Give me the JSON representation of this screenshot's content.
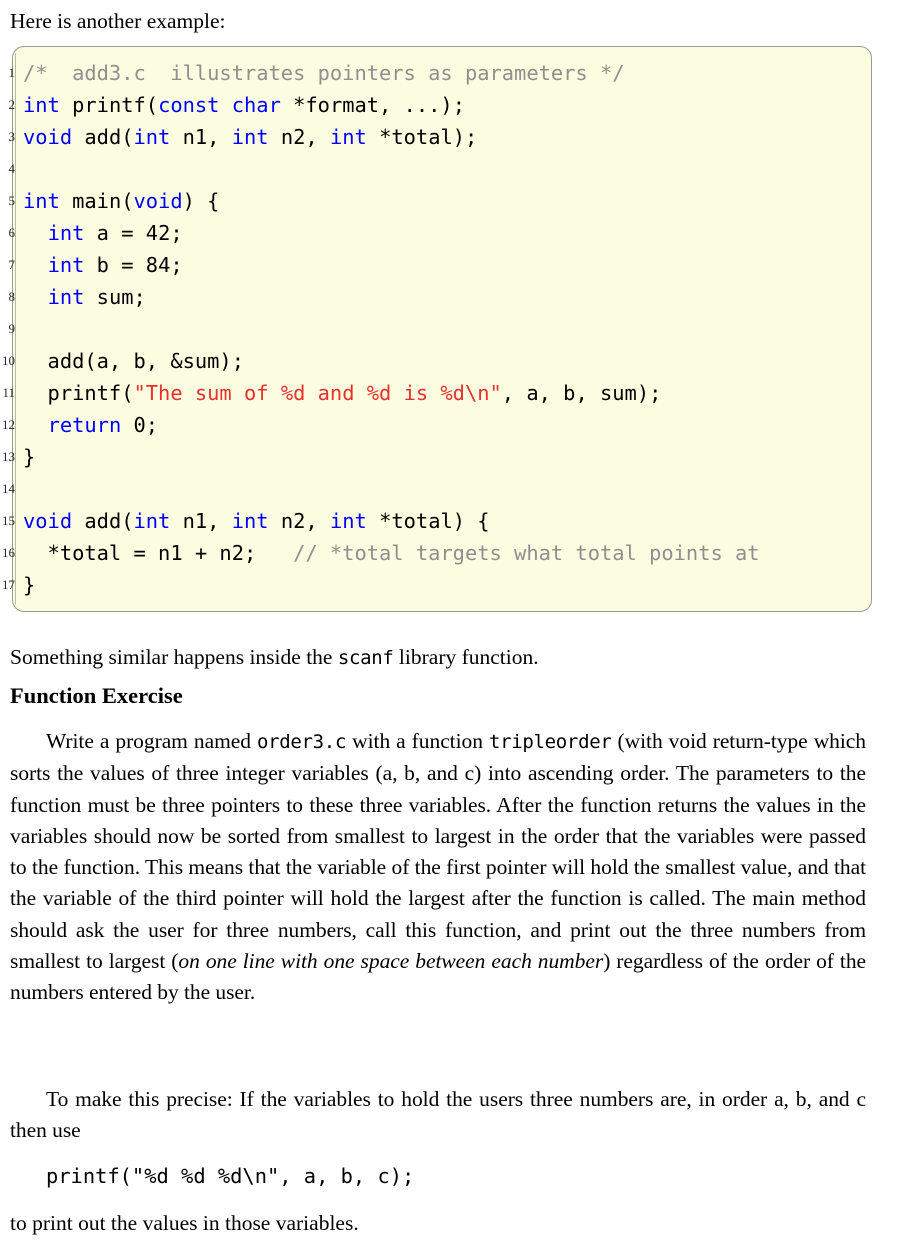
{
  "intro": {
    "text": "Here is another example:"
  },
  "listing": {
    "background_color": "#fcfce0",
    "border_color": "#9a9a93",
    "keyword_color": "#0000ff",
    "string_color": "#e8302c",
    "comment_color": "#8f8f8f",
    "lines": [
      {
        "n": "1",
        "tokens": [
          {
            "t": "cmt",
            "s": "/*  add3.c  illustrates pointers as parameters */"
          }
        ]
      },
      {
        "n": "2",
        "tokens": [
          {
            "t": "kw",
            "s": "int"
          },
          {
            "t": "pln",
            "s": " printf("
          },
          {
            "t": "kw",
            "s": "const"
          },
          {
            "t": "pln",
            "s": " "
          },
          {
            "t": "kw",
            "s": "char"
          },
          {
            "t": "pln",
            "s": " *format, ...);"
          }
        ]
      },
      {
        "n": "3",
        "tokens": [
          {
            "t": "kw",
            "s": "void"
          },
          {
            "t": "pln",
            "s": " add("
          },
          {
            "t": "kw",
            "s": "int"
          },
          {
            "t": "pln",
            "s": " n1, "
          },
          {
            "t": "kw",
            "s": "int"
          },
          {
            "t": "pln",
            "s": " n2, "
          },
          {
            "t": "kw",
            "s": "int"
          },
          {
            "t": "pln",
            "s": " *total);"
          }
        ]
      },
      {
        "n": "4",
        "tokens": [
          {
            "t": "pln",
            "s": ""
          }
        ]
      },
      {
        "n": "5",
        "tokens": [
          {
            "t": "kw",
            "s": "int"
          },
          {
            "t": "pln",
            "s": " main("
          },
          {
            "t": "kw",
            "s": "void"
          },
          {
            "t": "pln",
            "s": ") {"
          }
        ]
      },
      {
        "n": "6",
        "tokens": [
          {
            "t": "pln",
            "s": "  "
          },
          {
            "t": "kw",
            "s": "int"
          },
          {
            "t": "pln",
            "s": " a = 42;"
          }
        ]
      },
      {
        "n": "7",
        "tokens": [
          {
            "t": "pln",
            "s": "  "
          },
          {
            "t": "kw",
            "s": "int"
          },
          {
            "t": "pln",
            "s": " b = 84;"
          }
        ]
      },
      {
        "n": "8",
        "tokens": [
          {
            "t": "pln",
            "s": "  "
          },
          {
            "t": "kw",
            "s": "int"
          },
          {
            "t": "pln",
            "s": " sum;"
          }
        ]
      },
      {
        "n": "9",
        "tokens": [
          {
            "t": "pln",
            "s": ""
          }
        ]
      },
      {
        "n": "10",
        "tokens": [
          {
            "t": "pln",
            "s": "  add(a, b, &sum);"
          }
        ]
      },
      {
        "n": "11",
        "tokens": [
          {
            "t": "pln",
            "s": "  printf("
          },
          {
            "t": "str",
            "s": "\"The sum of %d and %d is %d\\n\""
          },
          {
            "t": "pln",
            "s": ", a, b, sum);"
          }
        ]
      },
      {
        "n": "12",
        "tokens": [
          {
            "t": "pln",
            "s": "  "
          },
          {
            "t": "kw",
            "s": "return"
          },
          {
            "t": "pln",
            "s": " 0;"
          }
        ]
      },
      {
        "n": "13",
        "tokens": [
          {
            "t": "pln",
            "s": "}"
          }
        ]
      },
      {
        "n": "14",
        "tokens": [
          {
            "t": "pln",
            "s": ""
          }
        ]
      },
      {
        "n": "15",
        "tokens": [
          {
            "t": "kw",
            "s": "void"
          },
          {
            "t": "pln",
            "s": " add("
          },
          {
            "t": "kw",
            "s": "int"
          },
          {
            "t": "pln",
            "s": " n1, "
          },
          {
            "t": "kw",
            "s": "int"
          },
          {
            "t": "pln",
            "s": " n2, "
          },
          {
            "t": "kw",
            "s": "int"
          },
          {
            "t": "pln",
            "s": " *total) {"
          }
        ]
      },
      {
        "n": "16",
        "tokens": [
          {
            "t": "pln",
            "s": "  *total = n1 + n2;   "
          },
          {
            "t": "cmt",
            "s": "// *total targets what total points at"
          }
        ]
      },
      {
        "n": "17",
        "tokens": [
          {
            "t": "pln",
            "s": "}"
          }
        ]
      }
    ]
  },
  "scanf_line": {
    "before": "Something similar happens inside the ",
    "code": "scanf",
    "after": " library function."
  },
  "section_heading": {
    "text": "Function Exercise"
  },
  "body_1": {
    "p1_a": "Write a program named ",
    "p1_code1": "order3.c",
    "p1_b": " with a function ",
    "p1_code2": "tripleorder",
    "p1_c": " (with void return-type which sorts the values of three integer variables (a, b, and c) into ascending order.  The parameters to the function must be three pointers to these three variables.  After the function returns the values in the variables should now be sorted from smallest to largest in the order that the variables were passed to the function.  This means that the variable of the first pointer will hold the smallest value, and that the variable of the third pointer will hold the largest after the function is called.  The main method should ask the user for three numbers, call this function, and print out the three numbers from smallest to largest (",
    "p1_italic": "on one line with one space between each number",
    "p1_d": ") regardless of the order of the numbers entered by the user."
  },
  "body_2": {
    "p2": "To make this precise:  If the variables to hold the users three numbers are, in order a, b, and c then use"
  },
  "snippet": {
    "text": "printf(\"%d %d %d\\n\", a, b, c);"
  },
  "tail": {
    "text": "to print out the values in those variables."
  }
}
